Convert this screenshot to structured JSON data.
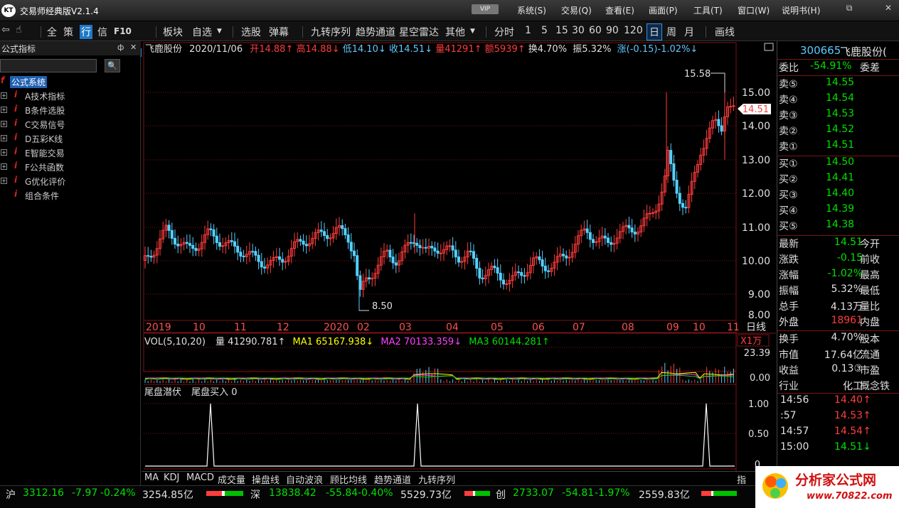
{
  "window": {
    "title": "交易师经典版V2.1.4",
    "vip": "VIP",
    "logo": "KT"
  },
  "menus": [
    "系统(S)",
    "交易(Q)",
    "查看(E)",
    "画面(P)",
    "工具(T)",
    "窗口(W)",
    "说明书(H)"
  ],
  "window_controls": {
    "restore": "⧉",
    "close": "✕"
  },
  "toolbar": {
    "items": [
      "全",
      "策",
      "行",
      "信",
      "F10",
      "板块",
      "自选",
      "选股",
      "弹幕",
      "九转序列",
      "趋势通道",
      "星空雷达",
      "其他",
      "分时",
      "1",
      "5",
      "15",
      "30",
      "60",
      "90",
      "120",
      "日",
      "周",
      "月",
      "画线"
    ],
    "active": "日",
    "active2": "行"
  },
  "left_panel": {
    "title": "公式指标",
    "search_placeholder": "",
    "root": "公式系统",
    "items": [
      "A技术指标",
      "B条件选股",
      "C交易信号",
      "D五彩K线",
      "E智能交易",
      "F公共函数",
      "G优化评价",
      "组合条件"
    ],
    "pin": "ф",
    "close": "✕"
  },
  "chart_header": {
    "name": "飞鹿股份",
    "date": "2020/11/06",
    "open": "开14.88↑",
    "high": "高14.88↓",
    "low": "低14.10↓",
    "close": "收14.51↓",
    "volume": "量41291↑",
    "amount": "额5939↑",
    "turnover": "换4.70%",
    "amplitude": "振5.32%",
    "change": "涨(-0.15)-1.02%↓"
  },
  "price_axis": [
    "15.00",
    "14.00",
    "13.00",
    "12.00",
    "11.00",
    "10.00",
    "9.00",
    "8.00"
  ],
  "price_tag": "14.51",
  "annot_high": "15.58",
  "annot_low": "8.50",
  "time_axis": [
    "2019",
    "10",
    "11",
    "12",
    "2020",
    "02",
    "03",
    "04",
    "05",
    "06",
    "07",
    "08",
    "09",
    "10",
    "11"
  ],
  "period_label": "日线",
  "vol_header": {
    "name": "VOL(5,10,20)",
    "vol": "量 41290.781↑",
    "ma1": "MA1 65167.938↓",
    "ma2": "MA2 70133.359↓",
    "ma3": "MA3 60144.281↑"
  },
  "vol_axis": {
    "unit": "X1万",
    "top": "23.39",
    "bottom": "0.00"
  },
  "ind_header": {
    "name": "尾盘潜伏",
    "item": "尾盘买入 0"
  },
  "ind_axis": [
    "1.00",
    "0.50",
    "0"
  ],
  "colors": {
    "up": "#ff3d3d",
    "down": "#00e000",
    "candle_down": "#54d0ff",
    "grid": "#7a1515",
    "ma1": "#ffff00",
    "ma2": "#ff40ff",
    "ma3": "#00e000"
  },
  "right_panel": {
    "code": "300665",
    "name": "飞鹿股份(",
    "weibi_label": "委比",
    "weibi_val": "-54.91%",
    "weicha": "委差",
    "sells": [
      {
        "l": "卖⑤",
        "p": "14.55"
      },
      {
        "l": "卖④",
        "p": "14.54"
      },
      {
        "l": "卖③",
        "p": "14.53"
      },
      {
        "l": "卖②",
        "p": "14.52"
      },
      {
        "l": "卖①",
        "p": "14.51"
      }
    ],
    "buys": [
      {
        "l": "买①",
        "p": "14.50"
      },
      {
        "l": "买②",
        "p": "14.41"
      },
      {
        "l": "买③",
        "p": "14.40"
      },
      {
        "l": "买④",
        "p": "14.39"
      },
      {
        "l": "买⑤",
        "p": "14.38"
      }
    ],
    "stats": [
      {
        "l": "最新",
        "v": "14.51",
        "r": "今开",
        "c": "green"
      },
      {
        "l": "涨跌",
        "v": "-0.15",
        "r": "前收",
        "c": "green"
      },
      {
        "l": "涨幅",
        "v": "-1.02%",
        "r": "最高",
        "c": "green"
      },
      {
        "l": "振幅",
        "v": "5.32%",
        "r": "最低",
        "c": "white"
      },
      {
        "l": "总手",
        "v": "4.13万",
        "r": "量比",
        "c": "white"
      },
      {
        "l": "外盘",
        "v": "18961",
        "r": "内盘",
        "c": "red"
      }
    ],
    "stats2": [
      {
        "l": "换手",
        "v": "4.70%",
        "r": "股本"
      },
      {
        "l": "市值",
        "v": "17.64亿",
        "r": "流通"
      },
      {
        "l": "收益",
        "v": "0.13③",
        "r": "市盈"
      },
      {
        "l": "行业",
        "v": "化工",
        "r": "概念铁"
      }
    ],
    "ticks": [
      {
        "t": "14:56",
        "p": "14.40↑",
        "c": "red"
      },
      {
        "t": ":57",
        "p": "14.53↑",
        "c": "red"
      },
      {
        "t": "14:57",
        "p": "14.54↑",
        "c": "red"
      },
      {
        "t": "15:00",
        "p": "14.51↓",
        "c": "green"
      }
    ]
  },
  "bottom_tabs": [
    "MA",
    "KDJ",
    "MACD",
    "成交量",
    "操盘线",
    "自动波浪",
    "顾比均线",
    "趋势通道",
    "九转序列"
  ],
  "tab_right": "指",
  "status": {
    "sh": {
      "label": "沪",
      "idx": "3312.16",
      "chg": "-7.97",
      "pct": "-0.24%",
      "amt": "3254.85亿"
    },
    "sz": {
      "label": "深",
      "idx": "13838.42",
      "chg": "-55.84",
      "pct": "-0.40%",
      "amt": "5529.73亿"
    },
    "cy": {
      "label": "创",
      "idx": "2733.07",
      "chg": "-54.81",
      "pct": "-1.97%",
      "amt": "2559.83亿"
    }
  },
  "brand": {
    "text": "分析家公式网",
    "url": "www.70822.com"
  }
}
